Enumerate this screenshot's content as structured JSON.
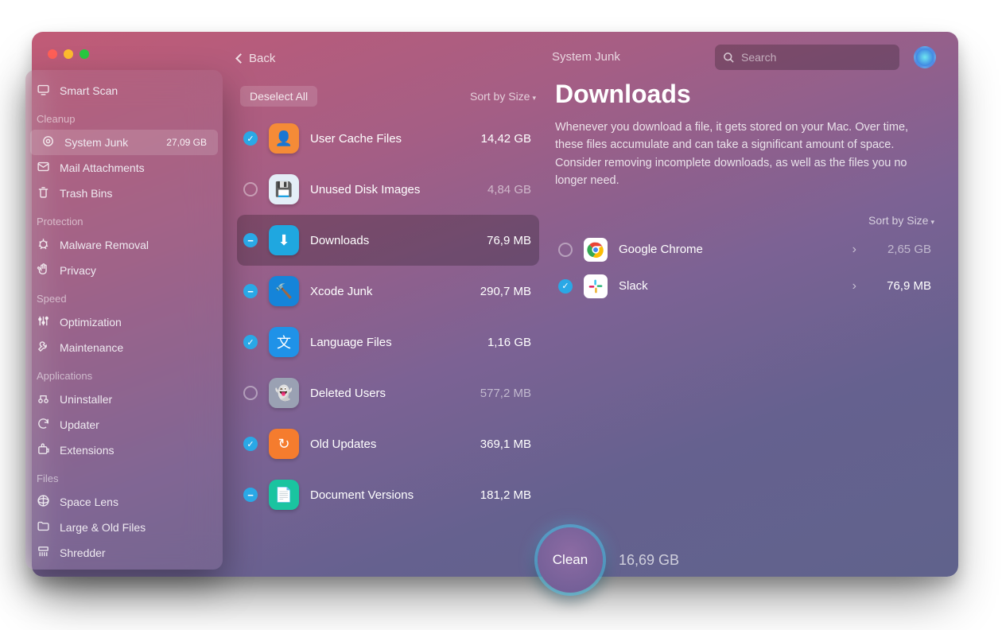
{
  "header": {
    "back_label": "Back",
    "breadcrumb": "System Junk",
    "search_placeholder": "Search"
  },
  "sidebar": {
    "smart_scan": "Smart Scan",
    "sections": [
      {
        "title": "Cleanup",
        "items": [
          {
            "label": "System Junk",
            "size": "27,09 GB",
            "active": true
          },
          {
            "label": "Mail Attachments"
          },
          {
            "label": "Trash Bins"
          }
        ]
      },
      {
        "title": "Protection",
        "items": [
          {
            "label": "Malware Removal"
          },
          {
            "label": "Privacy"
          }
        ]
      },
      {
        "title": "Speed",
        "items": [
          {
            "label": "Optimization"
          },
          {
            "label": "Maintenance"
          }
        ]
      },
      {
        "title": "Applications",
        "items": [
          {
            "label": "Uninstaller"
          },
          {
            "label": "Updater"
          },
          {
            "label": "Extensions"
          }
        ]
      },
      {
        "title": "Files",
        "items": [
          {
            "label": "Space Lens"
          },
          {
            "label": "Large & Old Files"
          },
          {
            "label": "Shredder"
          }
        ]
      }
    ]
  },
  "list": {
    "deselect_label": "Deselect All",
    "sort_label": "Sort by Size",
    "rows": [
      {
        "chk": "checked",
        "label": "User Cache Files",
        "size": "14,42 GB",
        "dim": false,
        "color": "#f58b37",
        "selected": false
      },
      {
        "chk": "empty",
        "label": "Unused Disk Images",
        "size": "4,84 GB",
        "dim": true,
        "color": "#e4eef7",
        "selected": false
      },
      {
        "chk": "minus",
        "label": "Downloads",
        "size": "76,9 MB",
        "dim": false,
        "color": "#1fa7e0",
        "selected": true
      },
      {
        "chk": "minus",
        "label": "Xcode Junk",
        "size": "290,7 MB",
        "dim": false,
        "color": "#1584d9",
        "selected": false
      },
      {
        "chk": "checked",
        "label": "Language Files",
        "size": "1,16 GB",
        "dim": false,
        "color": "#1f92e8",
        "selected": false
      },
      {
        "chk": "empty",
        "label": "Deleted Users",
        "size": "577,2 MB",
        "dim": true,
        "color": "#9aa1b3",
        "selected": false
      },
      {
        "chk": "checked",
        "label": "Old Updates",
        "size": "369,1 MB",
        "dim": false,
        "color": "#f57c2e",
        "selected": false
      },
      {
        "chk": "minus",
        "label": "Document Versions",
        "size": "181,2 MB",
        "dim": false,
        "color": "#1ac4a0",
        "selected": false
      }
    ]
  },
  "detail": {
    "title": "Downloads",
    "description": "Whenever you download a file, it gets stored on your Mac. Over time, these files accumulate and can take a significant amount of space. Consider removing incomplete downloads, as well as the files you no longer need.",
    "sort_label": "Sort by Size",
    "rows": [
      {
        "chk": "empty",
        "label": "Google Chrome",
        "size": "2,65 GB",
        "dim": true
      },
      {
        "chk": "checked",
        "label": "Slack",
        "size": "76,9 MB",
        "dim": false
      }
    ]
  },
  "footer": {
    "clean_label": "Clean",
    "clean_size": "16,69 GB"
  }
}
